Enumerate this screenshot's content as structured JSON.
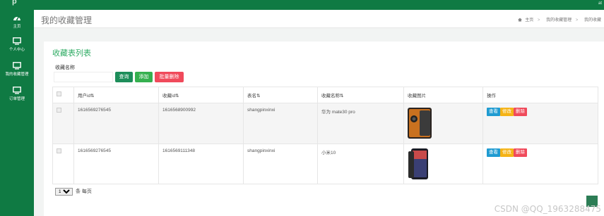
{
  "topbar": {
    "logo": "p",
    "user": "at"
  },
  "sidebar": {
    "items": [
      {
        "label": "主页",
        "icon": "dashboard-icon"
      },
      {
        "label": "个人中心",
        "icon": "monitor-icon"
      },
      {
        "label": "我的收藏管理",
        "icon": "monitor-icon"
      },
      {
        "label": "订单管理",
        "icon": "monitor-icon"
      }
    ]
  },
  "header": {
    "title": "我的收藏管理",
    "breadcrumb": [
      "主页",
      "我的收藏管理",
      "我的收藏"
    ]
  },
  "main": {
    "card_title": "收藏表列表",
    "search": {
      "label": "收藏名称",
      "value": "",
      "placeholder": ""
    },
    "buttons": {
      "query": "查询",
      "add": "添加",
      "batch_delete": "批量删除"
    },
    "table": {
      "headers": [
        "用户id⇅",
        "收藏id⇅",
        "表名⇅",
        "收藏名称⇅",
        "收藏图片",
        "操作"
      ],
      "rows": [
        {
          "user_id": "1616569276545",
          "fav_id": "1616568900992",
          "table_name": "shangpinxinxi",
          "fav_name": "华为 mate30 pro"
        },
        {
          "user_id": "1616569276545",
          "fav_id": "1616569111348",
          "table_name": "shangpinxinxi",
          "fav_name": "小米10"
        }
      ],
      "row_actions": {
        "view": "查看",
        "edit": "修改",
        "delete": "删除"
      }
    },
    "pager": {
      "page_size": "10",
      "suffix": "条 每页"
    }
  },
  "watermark": "CSDN @QQ_1963288475",
  "colors": {
    "sidebar": "#0f7a43",
    "accent_green": "#2eab63",
    "danger": "#f04a5b",
    "info": "#1f9bd1",
    "warning": "#f5b316"
  }
}
